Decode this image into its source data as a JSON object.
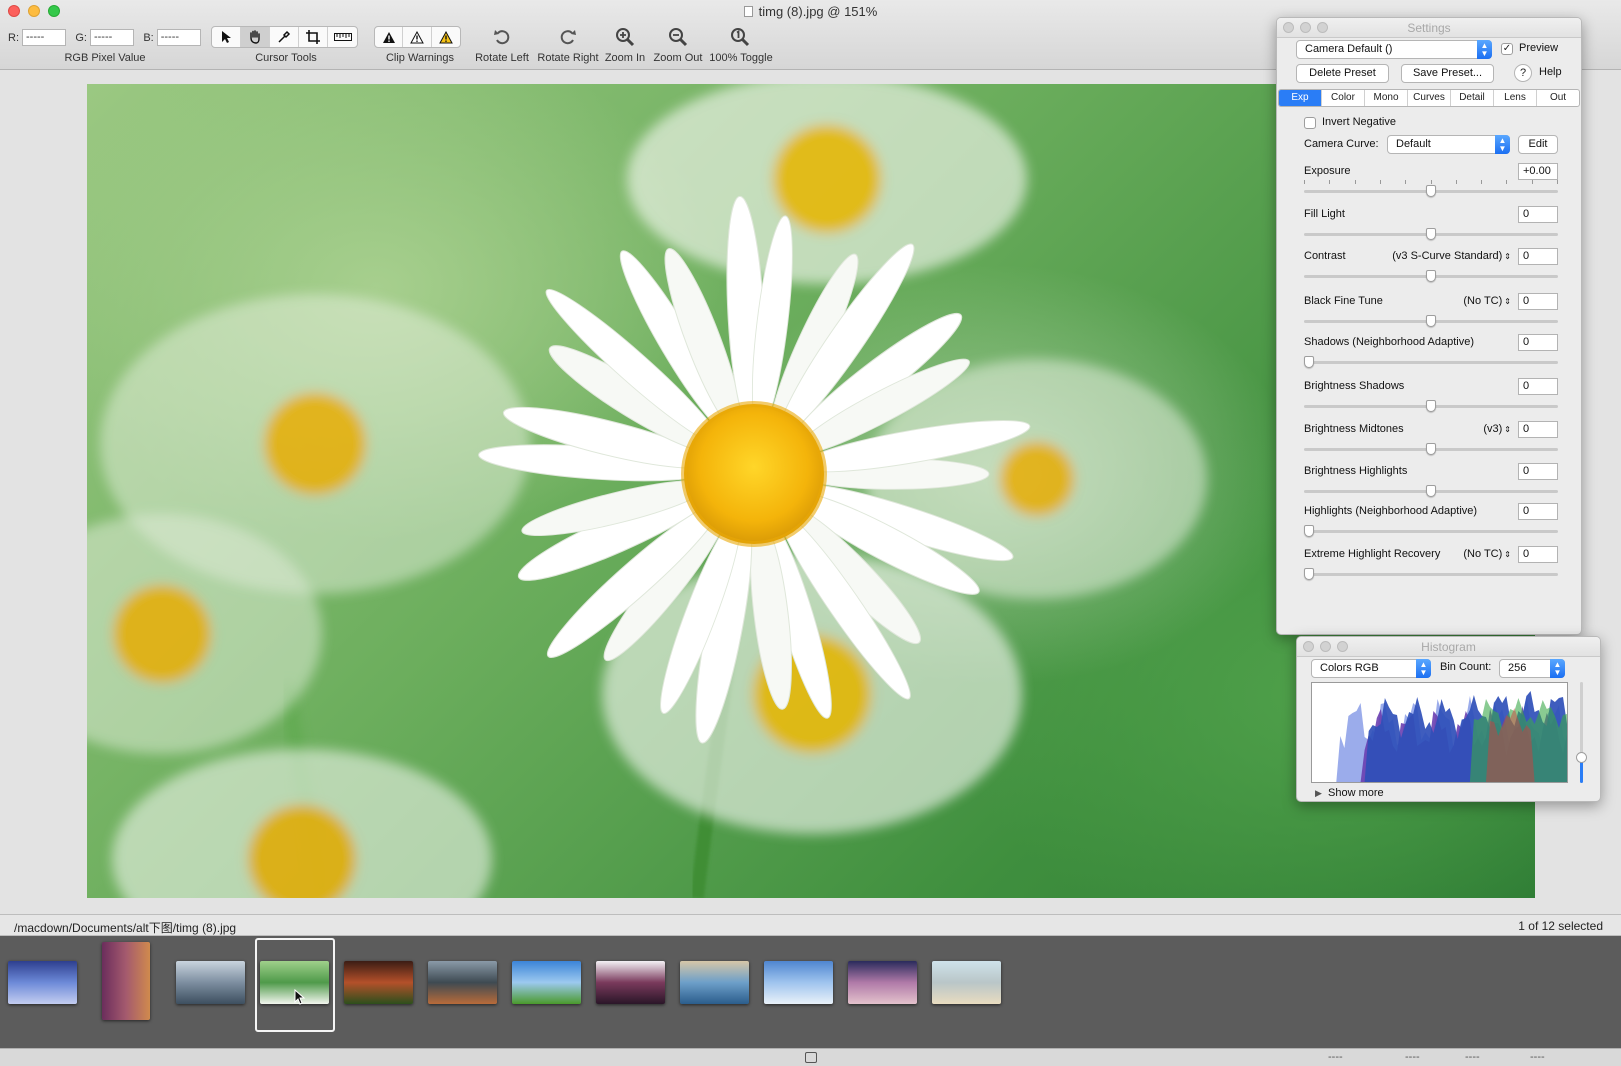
{
  "window": {
    "title": "timg (8).jpg @ 151%"
  },
  "toolbar": {
    "rgb": {
      "r_label": "R:",
      "r_value": "-----",
      "g_label": "G:",
      "g_value": "-----",
      "b_label": "B:",
      "b_value": "-----",
      "caption": "RGB Pixel Value"
    },
    "cursor_tools_caption": "Cursor Tools",
    "cursor_tools": [
      "arrow-cursor-icon",
      "hand-icon",
      "eyedropper-icon",
      "crop-icon",
      "ruler-icon"
    ],
    "selected_tool": "hand-icon",
    "clip_warnings_caption": "Clip Warnings",
    "rotate_left": "Rotate Left",
    "rotate_right": "Rotate Right",
    "zoom_in": "Zoom In",
    "zoom_out": "Zoom Out",
    "toggle_100": "100% Toggle"
  },
  "status": {
    "path": "/macdown/Documents/alt下图/timg (8).jpg",
    "selection": "1 of 12 selected",
    "dashes": [
      "----",
      "----",
      "----",
      "----"
    ]
  },
  "filmstrip": {
    "selected_index": 3,
    "thumbnails": [
      {
        "name": "mountain-lake",
        "colors": [
          "#2e3f8f",
          "#6d8ad8",
          "#c3cdf0"
        ]
      },
      {
        "name": "purple-field",
        "colors": [
          "#6b2d5c",
          "#a45a6e",
          "#d08a4d"
        ]
      },
      {
        "name": "coast-wave",
        "colors": [
          "#c9d4de",
          "#7d8ea0",
          "#3d4f5f"
        ]
      },
      {
        "name": "daisies",
        "colors": [
          "#9fd08a",
          "#4f9a4a",
          "#f2f5ee"
        ]
      },
      {
        "name": "sunset-field",
        "colors": [
          "#3b1d14",
          "#b4502a",
          "#2c4f1c"
        ]
      },
      {
        "name": "city-lights",
        "colors": [
          "#8a9aa8",
          "#3e4a52",
          "#b86b3a"
        ]
      },
      {
        "name": "green-hills",
        "colors": [
          "#3b84d8",
          "#9cc9ef",
          "#4a9a2c"
        ]
      },
      {
        "name": "pink-lake",
        "colors": [
          "#f4f1f5",
          "#7a3a5c",
          "#2a1628"
        ]
      },
      {
        "name": "blue-river",
        "colors": [
          "#d6c7a8",
          "#6d9fc9",
          "#2b5d8c"
        ]
      },
      {
        "name": "dandelions",
        "colors": [
          "#4f86d0",
          "#9fc4ee",
          "#e9f1f9"
        ]
      },
      {
        "name": "mauve-lake",
        "colors": [
          "#2a2b5c",
          "#b07aa8",
          "#e4c2cc"
        ]
      },
      {
        "name": "sand-beach",
        "colors": [
          "#cfe2ea",
          "#b9c6c8",
          "#e9dcc0"
        ]
      }
    ]
  },
  "settings": {
    "title": "Settings",
    "preset": "Camera Default ()",
    "preview_label": "Preview",
    "preview_checked": true,
    "delete_preset": "Delete Preset",
    "save_preset": "Save Preset...",
    "help_mark": "?",
    "help": "Help",
    "tabs": [
      "Exp",
      "Color",
      "Mono",
      "Curves",
      "Detail",
      "Lens",
      "Out"
    ],
    "active_tab": "Exp",
    "invert_negative": "Invert Negative",
    "camera_curve_label": "Camera Curve:",
    "camera_curve_value": "Default",
    "edit": "Edit",
    "controls": [
      {
        "label": "Exposure",
        "sub": "",
        "value": "+0.00",
        "position": 0.5,
        "ticks": true
      },
      {
        "label": "Fill Light",
        "sub": "",
        "value": "0",
        "position": 0.5,
        "ticks": false
      },
      {
        "label": "Contrast",
        "sub": "(v3 S-Curve Standard)",
        "value": "0",
        "position": 0.5,
        "ticks": false
      },
      {
        "label": "Black Fine Tune",
        "sub": "(No TC)",
        "value": "0",
        "position": 0.5,
        "ticks": false
      },
      {
        "label": "Shadows (Neighborhood Adaptive)",
        "sub": "",
        "value": "0",
        "position": 0.0,
        "ticks": false
      },
      {
        "label": "Brightness Shadows",
        "sub": "",
        "value": "0",
        "position": 0.5,
        "ticks": false
      },
      {
        "label": "Brightness Midtones",
        "sub": "(v3)",
        "value": "0",
        "position": 0.5,
        "ticks": false
      },
      {
        "label": "Brightness Highlights",
        "sub": "",
        "value": "0",
        "position": 0.5,
        "ticks": false
      },
      {
        "label": "Highlights (Neighborhood Adaptive)",
        "sub": "",
        "value": "0",
        "position": 0.0,
        "ticks": false
      },
      {
        "label": "Extreme Highlight Recovery",
        "sub": "(No TC)",
        "value": "0",
        "position": 0.0,
        "ticks": false
      }
    ]
  },
  "histogram": {
    "title": "Histogram",
    "mode": "Colors RGB",
    "bin_count_label": "Bin Count:",
    "bin_count": "256",
    "show_more": "Show more",
    "colors": {
      "blue": "#2f4fb8",
      "purple": "#6a3fb0",
      "light_blue": "#8a9ee8",
      "red": "#d93a3a",
      "green": "#3aa84a"
    }
  }
}
